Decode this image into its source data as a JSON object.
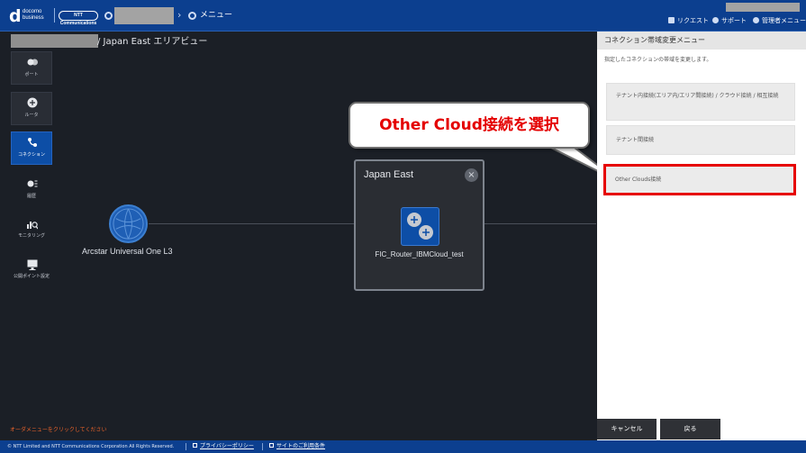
{
  "header": {
    "logo_main": "d",
    "logo_line1": "docomo",
    "logo_line2": "business",
    "ntt_logo": "NTT Communications",
    "breadcrumb_menu": "メニュー",
    "links": [
      {
        "label": "リクエスト",
        "icon": "bell-icon"
      },
      {
        "label": "サポート",
        "icon": "help-circle-icon"
      },
      {
        "label": "管理者メニュー",
        "icon": "gear-icon"
      }
    ]
  },
  "page": {
    "title": "/ Japan East エリアビュー"
  },
  "nav": [
    {
      "label": "ポート",
      "icon": "port-icon",
      "active": false
    },
    {
      "label": "ルータ",
      "icon": "router-icon",
      "active": false
    },
    {
      "label": "コネクション",
      "icon": "connection-icon",
      "active": true
    },
    {
      "label": "履歴",
      "icon": "history-icon",
      "active": false
    },
    {
      "label": "モニタリング",
      "icon": "monitoring-icon",
      "active": false
    },
    {
      "label": "公開ポイント設定",
      "icon": "monitor-icon",
      "active": false
    }
  ],
  "canvas": {
    "arcstar_label": "Arcstar Universal One L3",
    "area_title": "Japan East",
    "area_close": "×",
    "router_label": "FIC_Router_IBMCloud_test",
    "order_message": "オーダメニューをクリックしてください"
  },
  "callout": {
    "text": "Other Cloud接続を選択"
  },
  "panel": {
    "title": "コネクション帯域変更メニュー",
    "description": "指定したコネクションの帯域を変更します。",
    "options": [
      {
        "label": "テナント内接続(エリア内/エリア間接続) / クラウド接続 / 相互接続"
      },
      {
        "label": "テナント間接続"
      },
      {
        "label": "Other Clouds接続",
        "selected": true
      }
    ],
    "cancel_label": "キャンセル",
    "back_label": "戻る"
  },
  "footer": {
    "copyright": "© NTT Limited and NTT Communications Corporation All Rights Reserved.",
    "privacy_label": "プライバシーポリシー",
    "terms_label": "サイトのご利用条件"
  },
  "colors": {
    "header_bg": "#0c3f8f",
    "canvas_bg": "#1b1f26",
    "nav_active": "#0d4ea6",
    "highlight": "#e60000",
    "order_message": "#e8622a"
  }
}
